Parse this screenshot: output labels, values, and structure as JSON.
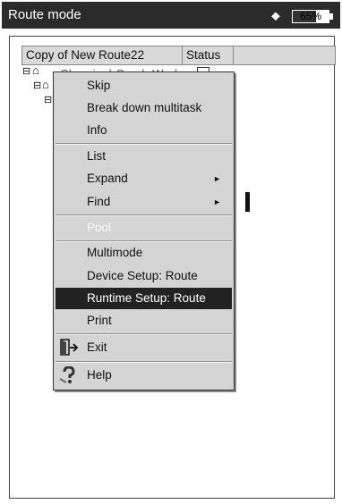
{
  "window": {
    "title": "Route mode",
    "bluetooth_icon": "bluetooth-icon",
    "battery_percent": "65%",
    "battery_level": 0.65
  },
  "table": {
    "headers": [
      "Copy of New Route22",
      "Status",
      ""
    ],
    "row_text": "Chemical Comb Work"
  },
  "menu": {
    "skip": "Skip",
    "break_down": "Break down multitask",
    "info": "Info",
    "list": "List",
    "expand": "Expand",
    "find": "Find",
    "pool": "Pool",
    "multimode": "Multimode",
    "device_setup": "Device Setup: Route",
    "runtime_setup": "Runtime Setup: Route",
    "print": "Print",
    "exit": "Exit",
    "help": "Help",
    "submenu_arrow": "►"
  },
  "icons": {
    "exit": "exit-door-icon",
    "help": "help-icon"
  }
}
